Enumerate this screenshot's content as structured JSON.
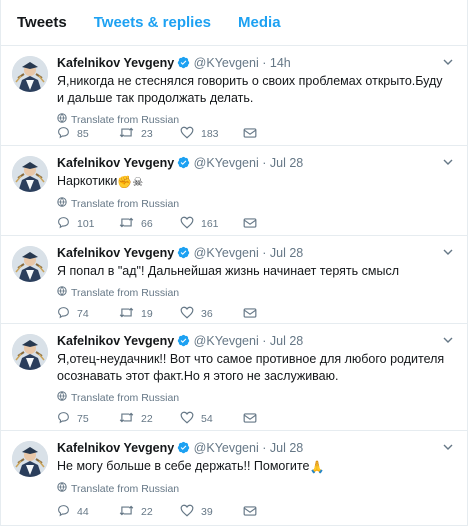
{
  "tabs": [
    {
      "label": "Tweets"
    },
    {
      "label": "Tweets & replies"
    },
    {
      "label": "Media"
    }
  ],
  "author": {
    "name": "Kafelnikov Yevgeny",
    "handle": "@KYevgeni"
  },
  "translate_label": "Translate from Russian",
  "colors": {
    "accent": "#1da1f2",
    "muted": "#657786",
    "border": "#e6ecf0"
  },
  "tweets": [
    {
      "time": "14h",
      "text": "Я,никогда не стеснялся говорить о своих проблемах открыто.Буду и дальше так продолжать делать.",
      "emoji": "",
      "replies": "85",
      "retweets": "23",
      "likes": "183"
    },
    {
      "time": "Jul 28",
      "text": "Наркотики",
      "emoji": "✊☠",
      "replies": "101",
      "retweets": "66",
      "likes": "161"
    },
    {
      "time": "Jul 28",
      "text": "Я попал в \"ад\"! Дальнейшая жизнь начинает терять смысл",
      "emoji": "",
      "replies": "74",
      "retweets": "19",
      "likes": "36"
    },
    {
      "time": "Jul 28",
      "text": "Я,отец-неудачник!! Вот что самое противное для любого родителя осознавать этот факт.Но я этого не заслуживаю.",
      "emoji": "",
      "replies": "75",
      "retweets": "22",
      "likes": "54"
    },
    {
      "time": "Jul 28",
      "text": "Не могу больше в себе держать!! Помогите",
      "emoji": "🙏",
      "replies": "44",
      "retweets": "22",
      "likes": "39"
    }
  ]
}
